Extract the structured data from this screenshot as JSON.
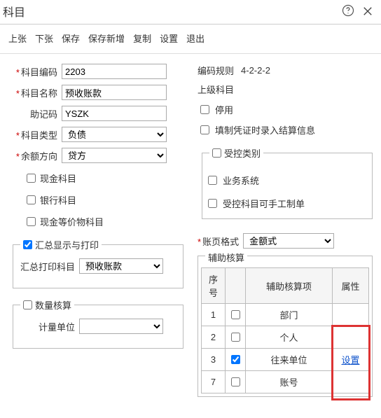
{
  "header": {
    "title": "科目"
  },
  "toolbar": {
    "prev": "上张",
    "next": "下张",
    "save": "保存",
    "saveNew": "保存新增",
    "copy": "复制",
    "settings": "设置",
    "exit": "退出"
  },
  "left": {
    "code_label": "科目编码",
    "code_value": "2203",
    "name_label": "科目名称",
    "name_value": "预收账款",
    "mnemonic_label": "助记码",
    "mnemonic_value": "YSZK",
    "type_label": "科目类型",
    "type_value": "负债",
    "direction_label": "余额方向",
    "direction_value": "贷方",
    "chk_cash": "现金科目",
    "chk_bank": "银行科目",
    "chk_cashequiv": "现金等价物科目",
    "group_summary_title": "汇总显示与打印",
    "summary_subject_label": "汇总打印科目",
    "summary_subject_value": "预收账款",
    "group_qty_title": "数量核算",
    "unit_label": "计量单位"
  },
  "right": {
    "rule_label": "编码规则",
    "rule_value": "4-2-2-2",
    "parent_label": "上级科目",
    "chk_disable": "停用",
    "chk_fillsettle": "填制凭证时录入结算信息",
    "controlled_title": "受控类别",
    "chk_biz": "业务系统",
    "chk_manual": "受控科目可手工制单",
    "format_label": "账页格式",
    "format_value": "金额式",
    "aux_title": "辅助核算",
    "table": {
      "h_seq": "序号",
      "h_chk": "",
      "h_item": "辅助核算项",
      "h_attr": "属性",
      "rows": [
        {
          "seq": "1",
          "checked": false,
          "item": "部门",
          "attr": ""
        },
        {
          "seq": "2",
          "checked": false,
          "item": "个人",
          "attr": ""
        },
        {
          "seq": "3",
          "checked": true,
          "item": "往来单位",
          "attr": "设置"
        },
        {
          "seq": "7",
          "checked": false,
          "item": "账号",
          "attr": ""
        }
      ]
    }
  }
}
